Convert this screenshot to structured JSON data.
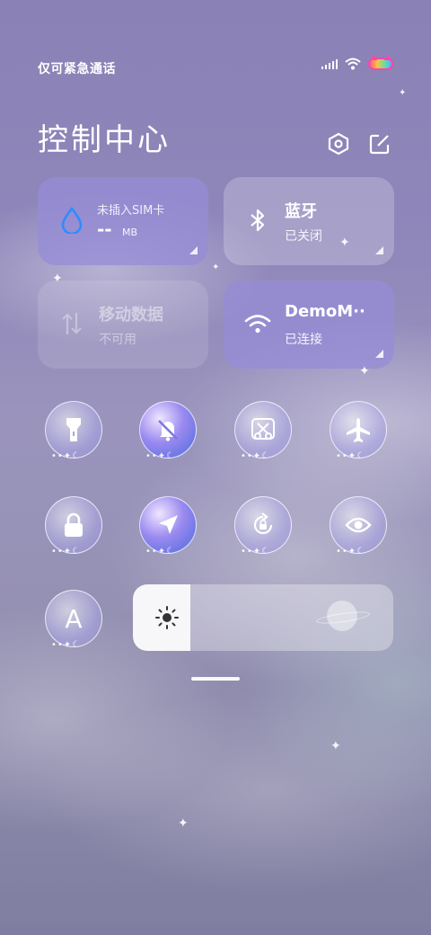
{
  "status_bar": {
    "carrier_text": "仅可紧急通话"
  },
  "header": {
    "title": "控制中心"
  },
  "cards": {
    "sim": {
      "label": "未插入SIM卡",
      "value": "--",
      "unit": "MB"
    },
    "bluetooth": {
      "title": "蓝牙",
      "subtitle": "已关闭"
    },
    "mobile_data": {
      "title": "移动数据",
      "subtitle": "不可用"
    },
    "wifi": {
      "title": "DemoM··",
      "subtitle": "已连接"
    }
  },
  "toggles": [
    {
      "name": "flashlight",
      "icon": "flashlight-icon",
      "on": false,
      "dots": "••✦☾"
    },
    {
      "name": "silent",
      "icon": "bell-off-icon",
      "on": true,
      "dots": "••✦☾"
    },
    {
      "name": "screenshot",
      "icon": "scissors-icon",
      "on": false,
      "dots": "••✦☾"
    },
    {
      "name": "airplane",
      "icon": "airplane-icon",
      "on": false,
      "dots": "••✦☾"
    },
    {
      "name": "lock-screen",
      "icon": "lock-icon",
      "on": false,
      "dots": "••✦☾"
    },
    {
      "name": "location",
      "icon": "location-arrow-icon",
      "on": true,
      "dots": "••✦☾"
    },
    {
      "name": "rotation-lock",
      "icon": "rotation-lock-icon",
      "on": false,
      "dots": "••✦☾"
    },
    {
      "name": "reading-mode",
      "icon": "eye-icon",
      "on": false,
      "dots": "••✦☾"
    },
    {
      "name": "auto-brightness",
      "icon": "letter-a-icon",
      "on": false,
      "dots": "••✦☾",
      "glyph": "A"
    }
  ],
  "brightness": {
    "level": 0.22
  },
  "colors": {
    "active_card": "#968cd7",
    "sim_icon": "#2f8cff",
    "slider_fill": "#f7f7f9"
  }
}
